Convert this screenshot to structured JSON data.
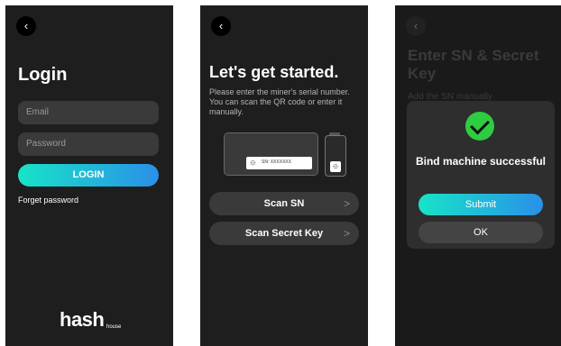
{
  "login_screen": {
    "back_icon": "chevron-left-icon",
    "title": "Login",
    "email_placeholder": "Email",
    "password_placeholder": "Password",
    "login_button": "LOGIN",
    "forget_password": "Forget password",
    "logo": {
      "text": "hash",
      "subtext": "house"
    }
  },
  "start_screen": {
    "back_icon": "chevron-left-icon",
    "title": "Let's get started.",
    "description": "Please enter the miner's serial number. You can scan the QR code or enter it manually.",
    "sn_label": "SN: XXXXXXX",
    "scan_sn_button": "Scan SN",
    "scan_secret_button": "Scan Secret Key",
    "chevron": ">"
  },
  "bind_screen": {
    "back_icon": "chevron-left-icon",
    "background_title": "Enter SN & Secret Key",
    "background_subtitle": "Add the SN manually",
    "modal": {
      "icon": "check-circle-icon",
      "message": "Bind machine successful",
      "submit_button": "Submit",
      "ok_button": "OK"
    }
  },
  "colors": {
    "screen_bg": "#1e1e1e",
    "gradient_start": "#18e3c8",
    "gradient_end": "#2a90e8",
    "success_green": "#2ecc40"
  }
}
